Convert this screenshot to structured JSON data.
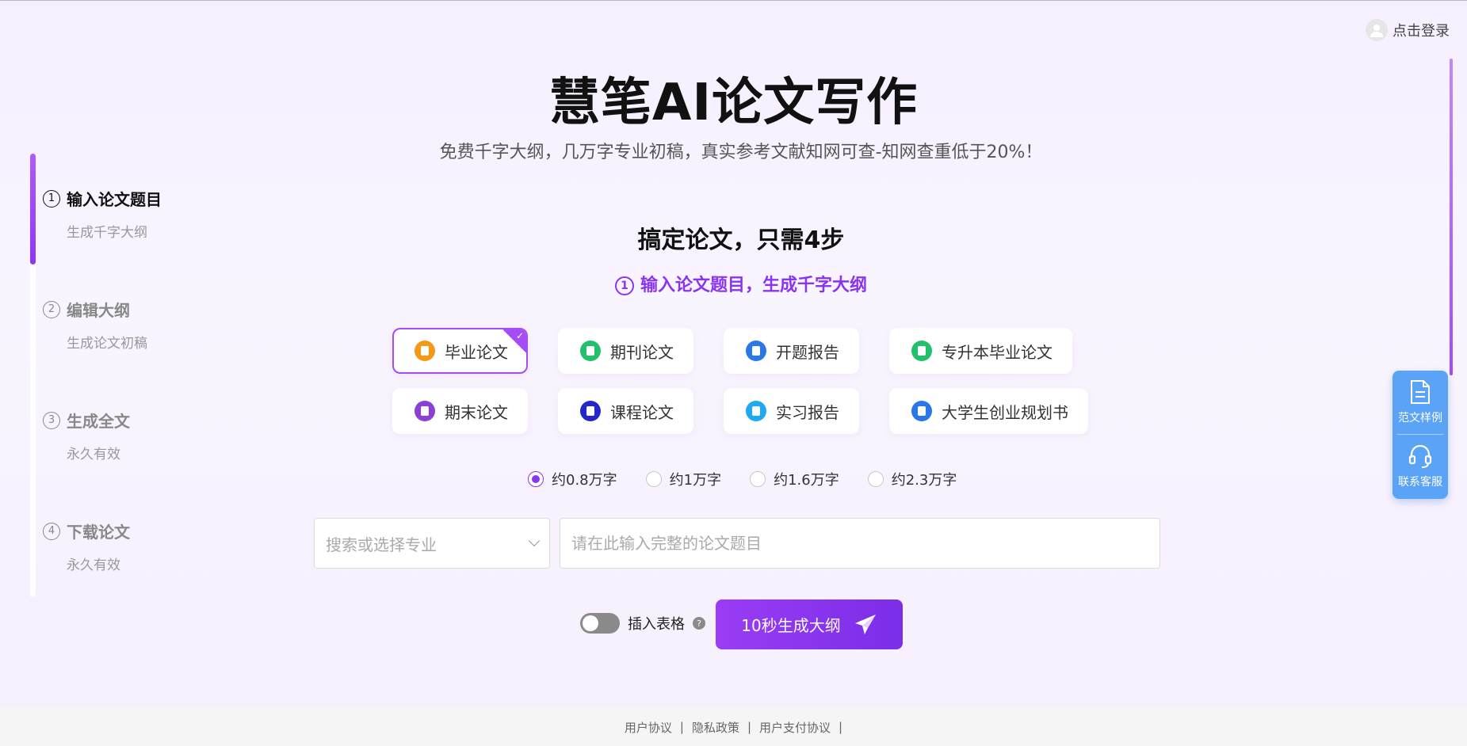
{
  "header": {
    "title": "慧笔AI论文写作",
    "subtitle": "免费千字大纲，几万字专业初稿，真实参考文献知网可查-知网查重低于20%！",
    "login_label": "点击登录"
  },
  "steps": [
    {
      "num": "1",
      "title": "输入论文题目",
      "sub": "生成千字大纲",
      "active": true
    },
    {
      "num": "2",
      "title": "编辑大纲",
      "sub": "生成论文初稿",
      "active": false
    },
    {
      "num": "3",
      "title": "生成全文",
      "sub": "永久有效",
      "active": false
    },
    {
      "num": "4",
      "title": "下载论文",
      "sub": "永久有效",
      "active": false
    }
  ],
  "main": {
    "headline": "搞定论文，只需4步",
    "step_hint_num": "1",
    "step_hint": "输入论文题目，生成千字大纲",
    "types": [
      {
        "label": "毕业论文",
        "color": "#f59a16",
        "selected": true
      },
      {
        "label": "期刊论文",
        "color": "#22c06a",
        "selected": false
      },
      {
        "label": "开题报告",
        "color": "#2a78e8",
        "selected": false
      },
      {
        "label": "专升本毕业论文",
        "color": "#22c06a",
        "selected": false
      },
      {
        "label": "期末论文",
        "color": "#8a3fd6",
        "selected": false
      },
      {
        "label": "课程论文",
        "color": "#2428c9",
        "selected": false
      },
      {
        "label": "实习报告",
        "color": "#1fa9f2",
        "selected": false
      },
      {
        "label": "大学生创业规划书",
        "color": "#2a78e8",
        "selected": false
      }
    ],
    "word_counts": [
      {
        "label": "约0.8万字",
        "checked": true
      },
      {
        "label": "约1万字",
        "checked": false
      },
      {
        "label": "约1.6万字",
        "checked": false
      },
      {
        "label": "约2.3万字",
        "checked": false
      }
    ],
    "major_placeholder": "搜索或选择专业",
    "title_placeholder": "请在此输入完整的论文题目",
    "insert_table_label": "插入表格",
    "insert_table_on": false,
    "help_glyph": "?",
    "generate_label": "10秒生成大纲"
  },
  "float_panel": {
    "sample_label": "范文样例",
    "service_label": "联系客服"
  },
  "footer": {
    "links": [
      "用户协议",
      "隐私政策",
      "用户支付协议"
    ],
    "separator": "|"
  },
  "colors": {
    "accent": "#8a34f0",
    "float_blue": "#5aa3f7"
  }
}
